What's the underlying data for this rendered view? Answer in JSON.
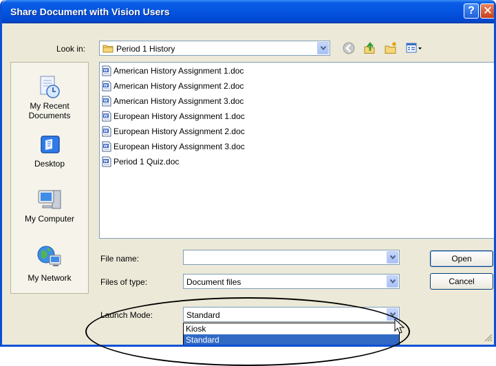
{
  "window": {
    "title": "Share Document with Vision Users"
  },
  "look_in": {
    "label": "Look in:",
    "value": "Period 1 History"
  },
  "places": [
    {
      "label_line1": "My Recent",
      "label_line2": "Documents"
    },
    {
      "label_line1": "Desktop"
    },
    {
      "label_line1": "My Computer"
    },
    {
      "label_line1": "My Network"
    }
  ],
  "files": [
    "American History Assignment 1.doc",
    "American History Assignment 2.doc",
    "American History Assignment 3.doc",
    "European History Assignment 1.doc",
    "European History Assignment 2.doc",
    "European History Assignment 3.doc",
    "Period 1 Quiz.doc"
  ],
  "file_name": {
    "label": "File name:",
    "value": ""
  },
  "file_type": {
    "label": "Files of type:",
    "value": "Document files"
  },
  "launch_mode": {
    "label": "Launch Mode:",
    "value": "Standard",
    "options": [
      "Kiosk",
      "Standard"
    ]
  },
  "buttons": {
    "open": "Open",
    "cancel": "Cancel"
  },
  "icons": {
    "back": "back-icon",
    "up": "up-folder-icon",
    "new_folder": "new-folder-icon",
    "views": "views-menu-icon"
  },
  "colors": {
    "titlebar": "#0554e0",
    "selection": "#316ac5",
    "dialog": "#ece9d8"
  }
}
